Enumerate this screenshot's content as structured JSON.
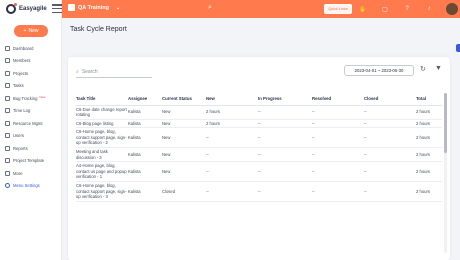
{
  "app": {
    "logo_text": "Easyagile",
    "new_button": "New",
    "new_badge": "New"
  },
  "sidebar": {
    "items": [
      {
        "label": "Dashboard",
        "icon": "dashboard-icon"
      },
      {
        "label": "Members",
        "icon": "members-icon"
      },
      {
        "label": "Projects",
        "icon": "projects-icon"
      },
      {
        "label": "Tasks",
        "icon": "tasks-icon"
      },
      {
        "label": "Bug Tracking",
        "icon": "bug-icon"
      },
      {
        "label": "Time Log",
        "icon": "clock-icon"
      },
      {
        "label": "Resource Mgmt",
        "icon": "resource-icon"
      },
      {
        "label": "Users",
        "icon": "users-icon"
      },
      {
        "label": "Reports",
        "icon": "reports-icon"
      },
      {
        "label": "Project Template",
        "icon": "template-icon"
      },
      {
        "label": "More",
        "icon": "more-icon"
      },
      {
        "label": "Menu Settings",
        "icon": "settings-icon"
      }
    ]
  },
  "topbar": {
    "project_name": "QA Training",
    "quick_links": "Quick Links"
  },
  "page": {
    "title": "Task Cycle Report"
  },
  "controls": {
    "search_placeholder": "Search",
    "date_range": "2023-04-01 ~ 2023-05-30"
  },
  "table": {
    "headers": [
      "Task Title",
      "Assignee",
      "Current Status",
      "New",
      "In Progress",
      "Resolved",
      "Closed",
      "Total"
    ],
    "rows": [
      [
        "C6-Due date change report rotating",
        "Kalista",
        "New",
        "2 hours",
        "--",
        "--",
        "--",
        "2 hours"
      ],
      [
        "C6-Blog page listing",
        "Kalista",
        "New",
        "2 hours",
        "--",
        "--",
        "--",
        "2 hours"
      ],
      [
        "C6-Home page, blog, contact support page, sign-up verification - 2",
        "Kalista",
        "New",
        "--",
        "--",
        "--",
        "--",
        "2 hours"
      ],
      [
        "Meeting and task discussion - 3",
        "Kalista",
        "New",
        "--",
        "--",
        "--",
        "--",
        "2 hours"
      ],
      [
        "A4-Home page, blog, contact us page and popup verification - 1",
        "Kalista",
        "New",
        "--",
        "--",
        "--",
        "--",
        "2 hours"
      ],
      [
        "C6-Home page, blog, contact support page, sign-up verification - 3",
        "Kalista",
        "Closed",
        "--",
        "--",
        "--",
        "--",
        "2 hours"
      ]
    ]
  },
  "colors": {
    "accent": "#ff7a4d",
    "active_nav": "#3d5bd9"
  }
}
